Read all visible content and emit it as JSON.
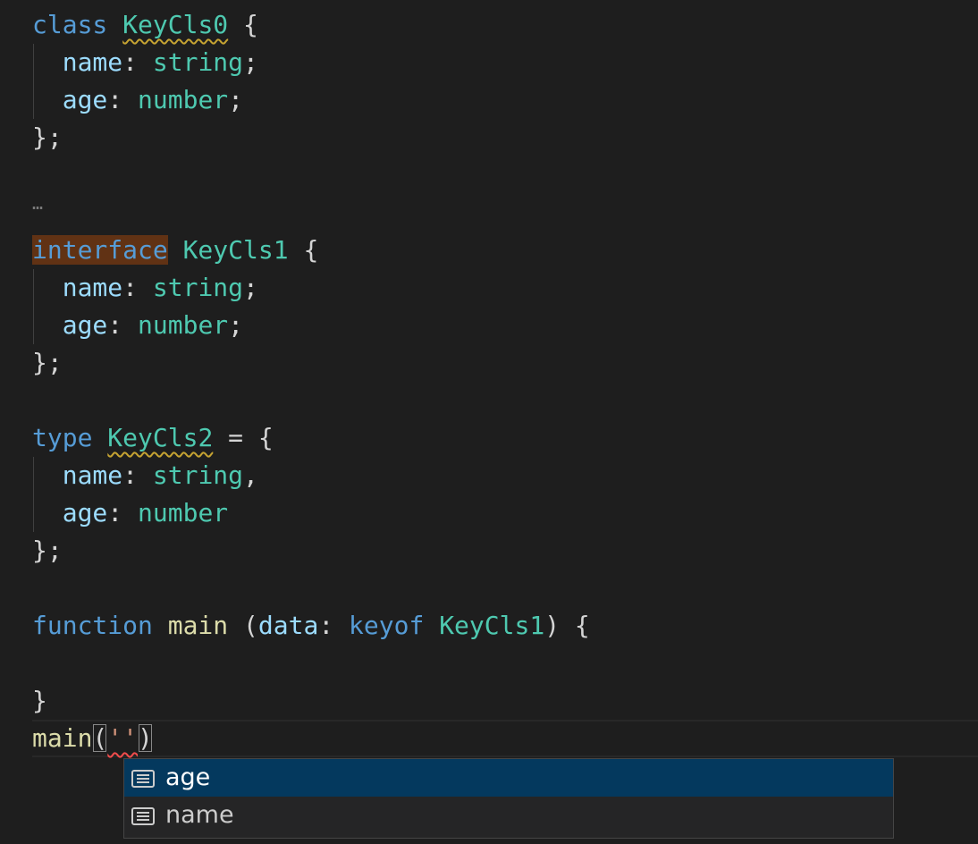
{
  "code": {
    "l1": {
      "kw": "class",
      "name": "KeyCls0",
      "brace": " {"
    },
    "l2": {
      "prop": "name",
      "colon": ": ",
      "type": "string",
      "end": ";"
    },
    "l3": {
      "prop": "age",
      "colon": ": ",
      "type": "number",
      "end": ";"
    },
    "l4": {
      "text": "};"
    },
    "fold": {
      "text": "…"
    },
    "l6": {
      "kw": "interface",
      "name": "KeyCls1",
      "brace": " {"
    },
    "l7": {
      "prop": "name",
      "colon": ": ",
      "type": "string",
      "end": ";"
    },
    "l8": {
      "prop": "age",
      "colon": ": ",
      "type": "number",
      "end": ";"
    },
    "l9": {
      "text": "};"
    },
    "l11": {
      "kw": "type",
      "name": "KeyCls2",
      "rest": " = {"
    },
    "l12": {
      "prop": "name",
      "colon": ": ",
      "type": "string",
      "end": ","
    },
    "l13": {
      "prop": "age",
      "colon": ": ",
      "type": "number"
    },
    "l14": {
      "text": "};"
    },
    "l16": {
      "kw": "function",
      "fname": "main",
      "open": " (",
      "param": "data",
      "colon": ": ",
      "kw2": "keyof",
      "type": "KeyCls1",
      "close": ") {"
    },
    "l18": {
      "text": "}"
    },
    "l19": {
      "fname": "main",
      "open": "(",
      "str": "''",
      "close": ")"
    }
  },
  "suggest": {
    "items": [
      {
        "label": "age",
        "icon": "field-icon",
        "selected": true
      },
      {
        "label": "name",
        "icon": "field-icon",
        "selected": false
      }
    ]
  },
  "colors": {
    "keyword": "#569cd6",
    "type": "#4ec9b0",
    "property": "#9cdcfe",
    "function": "#dcdcaa",
    "string": "#ce9178",
    "selection": "#04395e",
    "word_highlight": "#613214"
  }
}
